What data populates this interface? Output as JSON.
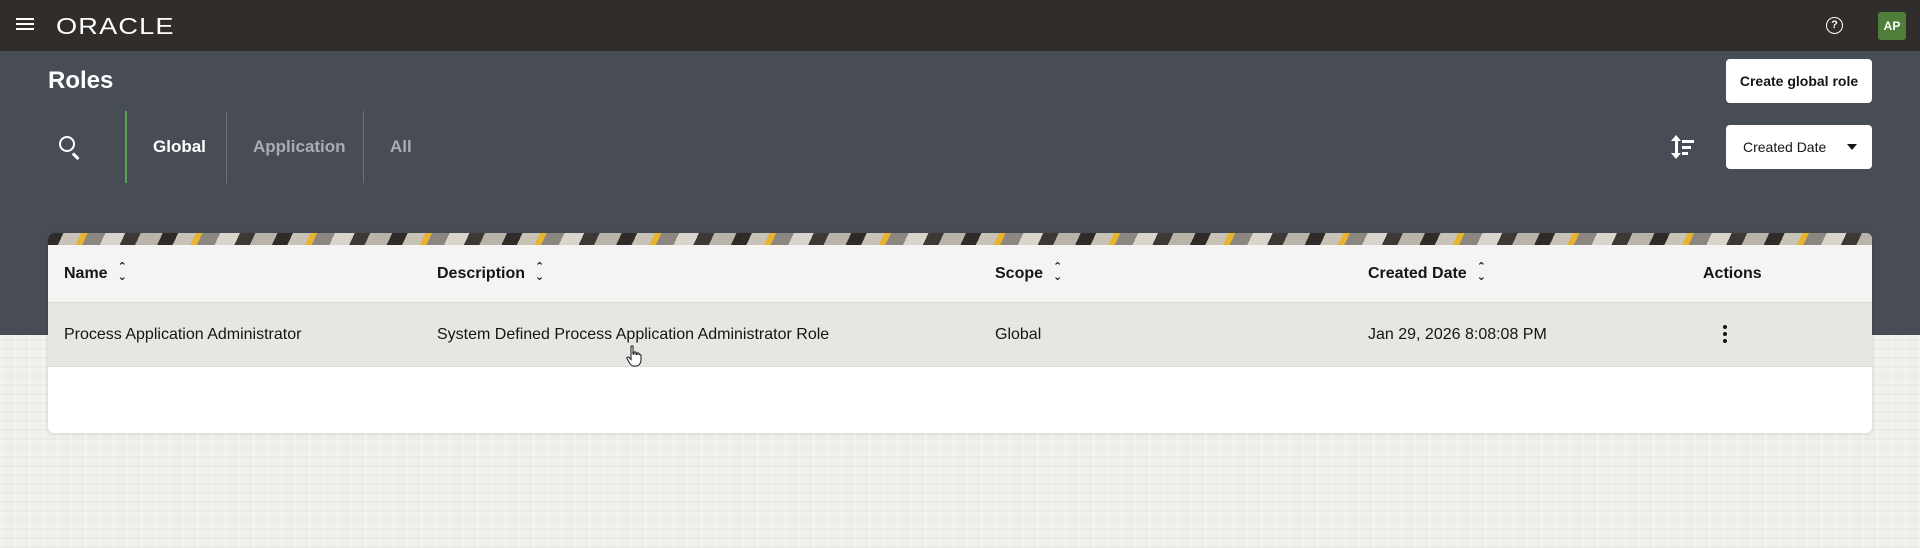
{
  "topbar": {
    "logo_text": "ORACLE",
    "help_glyph": "?",
    "avatar_initials": "AP"
  },
  "header": {
    "title": "Roles",
    "create_button_label": "Create global role",
    "tabs": [
      {
        "label": "Global",
        "active": true
      },
      {
        "label": "Application",
        "active": false
      },
      {
        "label": "All",
        "active": false
      }
    ],
    "sort": {
      "selected": "Created Date"
    }
  },
  "table": {
    "columns": [
      "Name",
      "Description",
      "Scope",
      "Created Date",
      "Actions"
    ],
    "rows": [
      {
        "name": "Process Application Administrator",
        "description": "System Defined Process Application Administrator Role",
        "scope": "Global",
        "created_date": "Jan 29, 2026 8:08:08 PM"
      }
    ]
  },
  "colors": {
    "topbar_bg": "#312d2a",
    "header_bg": "#474c55",
    "active_tab_accent": "#5ca356",
    "avatar_bg": "#4f7d3a"
  },
  "icons": {
    "menu": "hamburger-icon",
    "help": "help-icon",
    "search": "search-icon",
    "sort": "sort-icon",
    "dropdown": "chevron-down-icon",
    "column_sort": "sort-arrows-icon",
    "row_actions": "kebab-menu-icon"
  }
}
